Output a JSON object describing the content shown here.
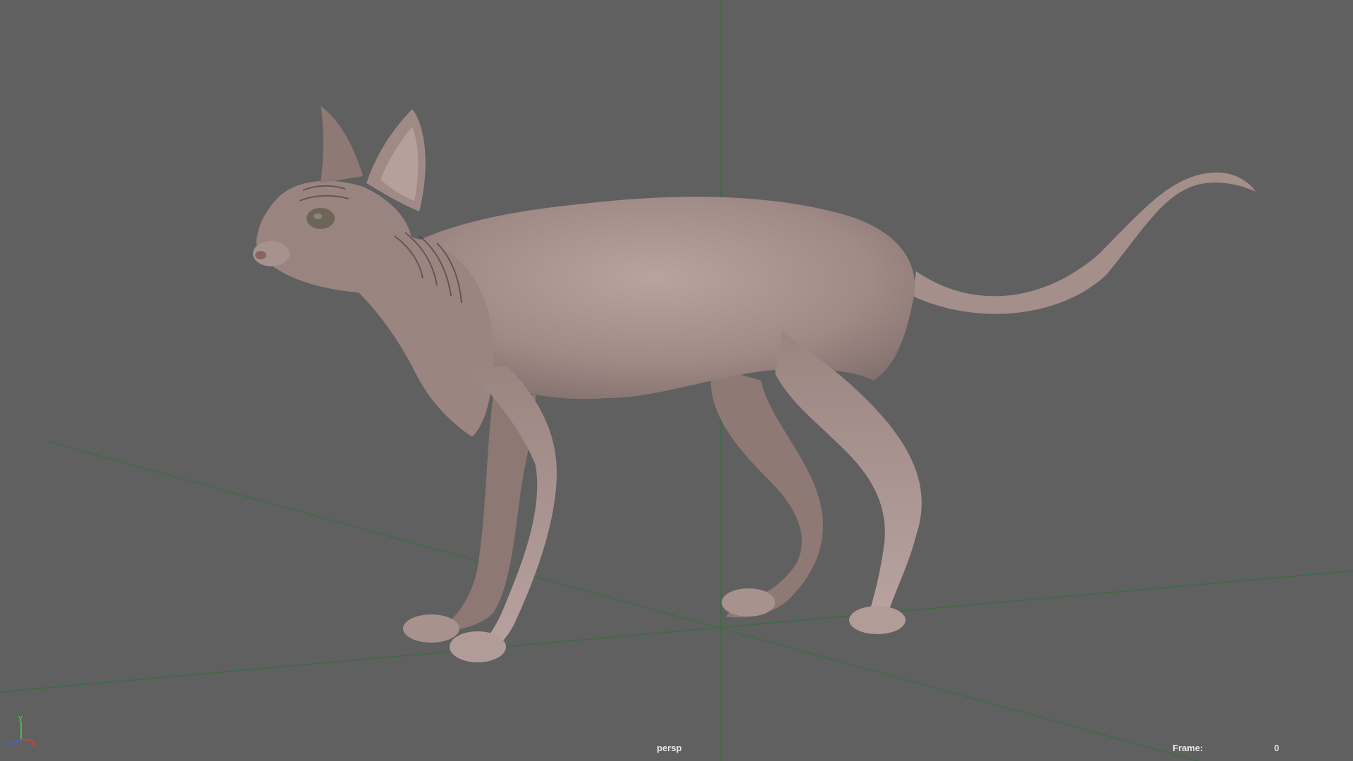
{
  "viewport": {
    "camera_name": "persp",
    "frame_label": "Frame:",
    "frame_value": "0",
    "background_color": "#606060",
    "grid_color": "#3e6b45",
    "model_subject": "sphynx-cat-model"
  },
  "axis_gizmo": {
    "x_label": "x",
    "y_label": "y",
    "z_label": "z",
    "x_color": "#d04040",
    "y_color": "#40c040",
    "z_color": "#4060e0"
  }
}
